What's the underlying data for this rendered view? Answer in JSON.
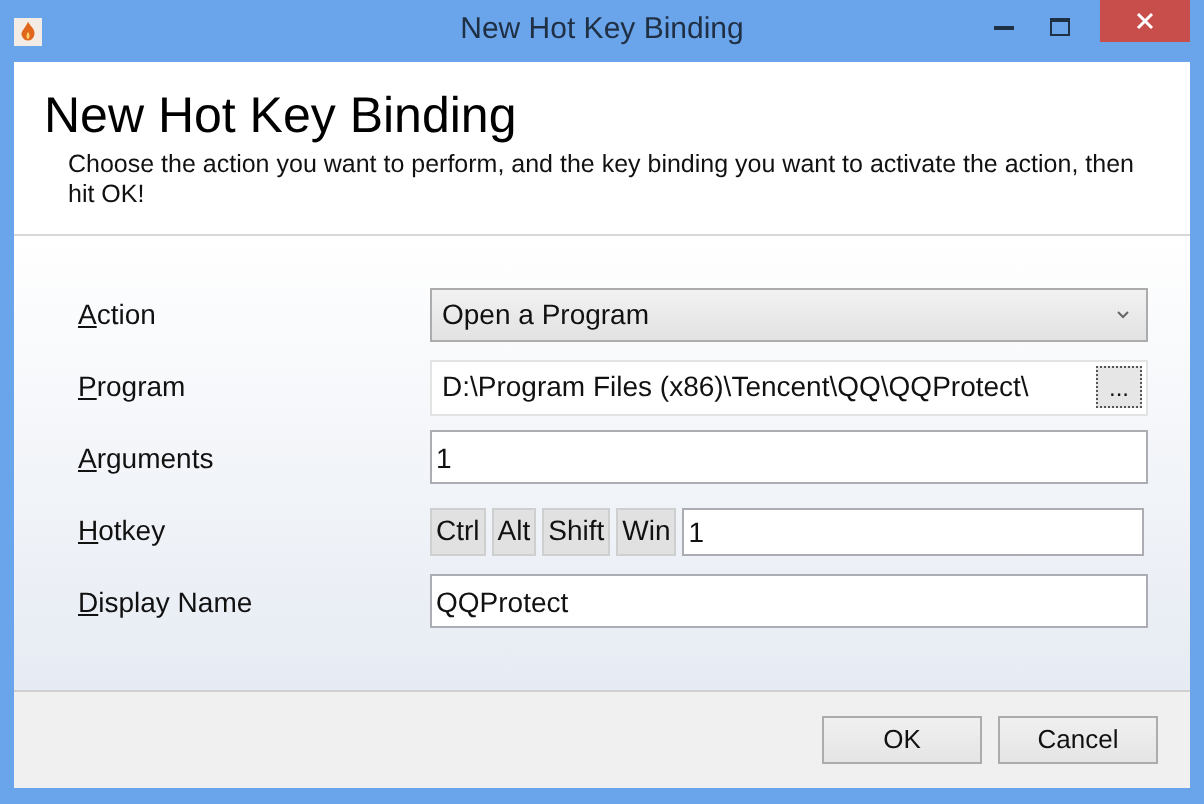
{
  "window": {
    "title": "New Hot Key Binding"
  },
  "header": {
    "title": "New Hot Key Binding",
    "description": "Choose the action you want to perform, and the key binding you want to activate the action, then hit OK!"
  },
  "fields": [
    {
      "kind": "dropdown",
      "label": "Action",
      "access_key_underlined": true,
      "value": "Open a Program"
    },
    {
      "kind": "browse",
      "label": "Program",
      "access_key_underlined": true,
      "value": "D:\\Program Files (x86)\\Tencent\\QQ\\QQProtect\\",
      "button": "..."
    },
    {
      "kind": "text",
      "label": "Arguments",
      "access_key_underlined": true,
      "value": "1"
    },
    {
      "kind": "hotkey",
      "label": "Hotkey",
      "access_key_underlined": true,
      "modifiers": [
        "Ctrl",
        "Alt",
        "Shift",
        "Win"
      ],
      "value": "1"
    },
    {
      "kind": "text",
      "label": "Display Name",
      "access_key_underlined": true,
      "value": "QQProtect"
    }
  ],
  "buttons": [
    "OK",
    "Cancel"
  ]
}
